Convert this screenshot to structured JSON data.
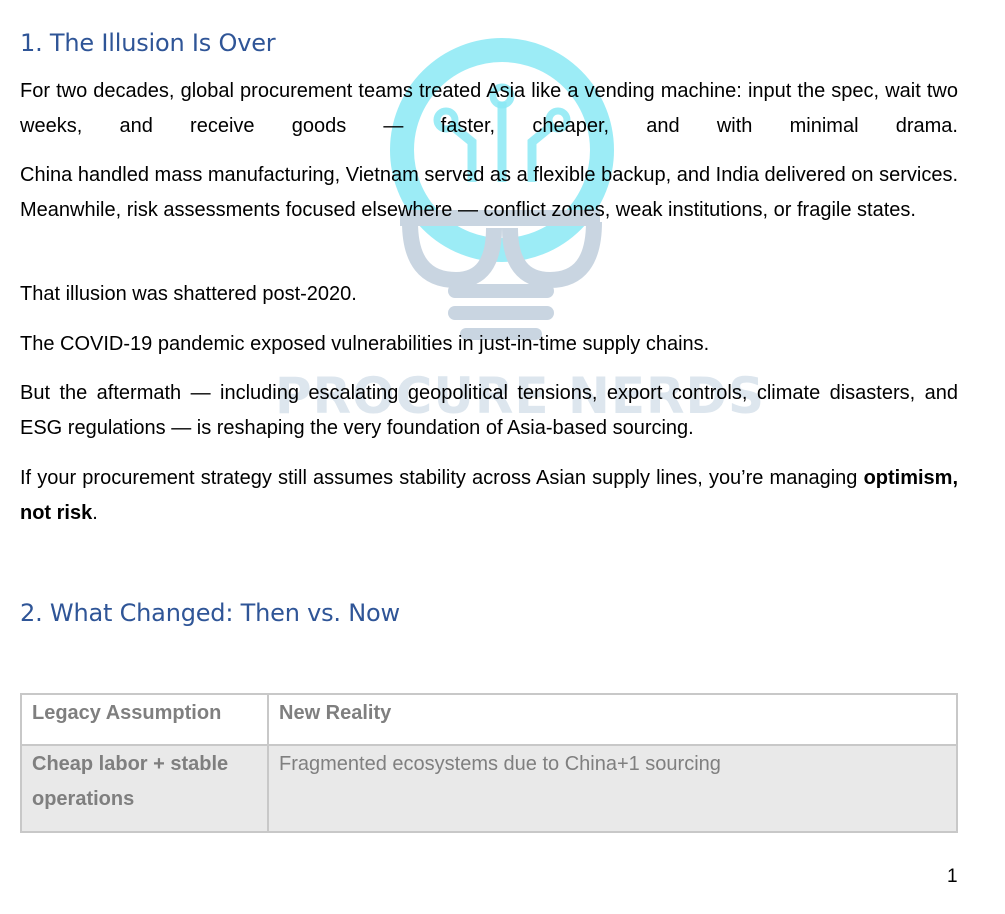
{
  "watermark": {
    "logo_icon": "lightbulb-glasses-icon",
    "text": "PROCURE NERDS",
    "colors": {
      "cyan": "#7fe7f4",
      "slate": "#c9d5e1"
    }
  },
  "section1": {
    "heading": "1. The Illusion Is Over",
    "paragraphs": [
      "For two decades, global procurement teams treated Asia like a vending machine: input the spec, wait two weeks, and receive goods — faster, cheaper, and with minimal drama.",
      "China handled mass manufacturing, Vietnam served as a flexible backup, and India delivered on services. Meanwhile, risk assessments focused elsewhere — conflict zones, weak institutions, or fragile states.",
      "That illusion was shattered post-2020.",
      "The COVID-19 pandemic exposed vulnerabilities in just-in-time supply chains.",
      "But the aftermath — including escalating geopolitical tensions, export controls, climate disasters, and ESG regulations — is reshaping the very foundation of Asia-based sourcing."
    ],
    "closing": {
      "text": "If your procurement strategy still assumes stability across Asian supply lines, you’re managing",
      "bold": "optimism, not risk",
      "end": "."
    }
  },
  "section2": {
    "heading": "2. What Changed: Then vs. Now",
    "table": {
      "headers": [
        "Legacy Assumption",
        "New Reality"
      ],
      "rows": [
        [
          "Cheap labor + stable operations",
          "Fragmented ecosystems due to China+1 sourcing"
        ]
      ]
    }
  },
  "footer": {
    "page_number": "1"
  },
  "colors": {
    "heading": "#2f5597",
    "table_text": "#7f7f7f",
    "table_row_bg": "#e9e9e9"
  }
}
